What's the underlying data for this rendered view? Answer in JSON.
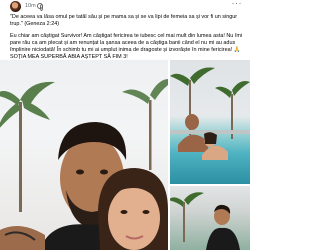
{
  "post": {
    "timestamp": "10m",
    "caption": [
      "\"De aceea va lăsa omul pe tatăl său și pe mama sa și se va lipi de femeia sa și vor fi un singur trup.\" (Geneza 2:24)",
      "Eu chiar am câștigat Survivor! Am câștigat fericirea te iubesc cel mai mult din lumea asta! Nu îmi pare rău ca am plecat și am renunțat la șansa aceea de a câștiga banii când el nu mi au adus împlinire niciodată! În schimb tu mi ai umplut inima de dragoste și izvorăște în mine fericirea! 🙏 SOȚIA MEA SUPERBĂ ABIA AȘTEPT SĂ FIM 3!"
    ]
  },
  "colors": {
    "text_primary": "#050505",
    "text_secondary": "#65676b",
    "pool_water": "#4fb3c2"
  },
  "icons": {
    "privacy": "globe-icon",
    "menu": "more-icon"
  }
}
